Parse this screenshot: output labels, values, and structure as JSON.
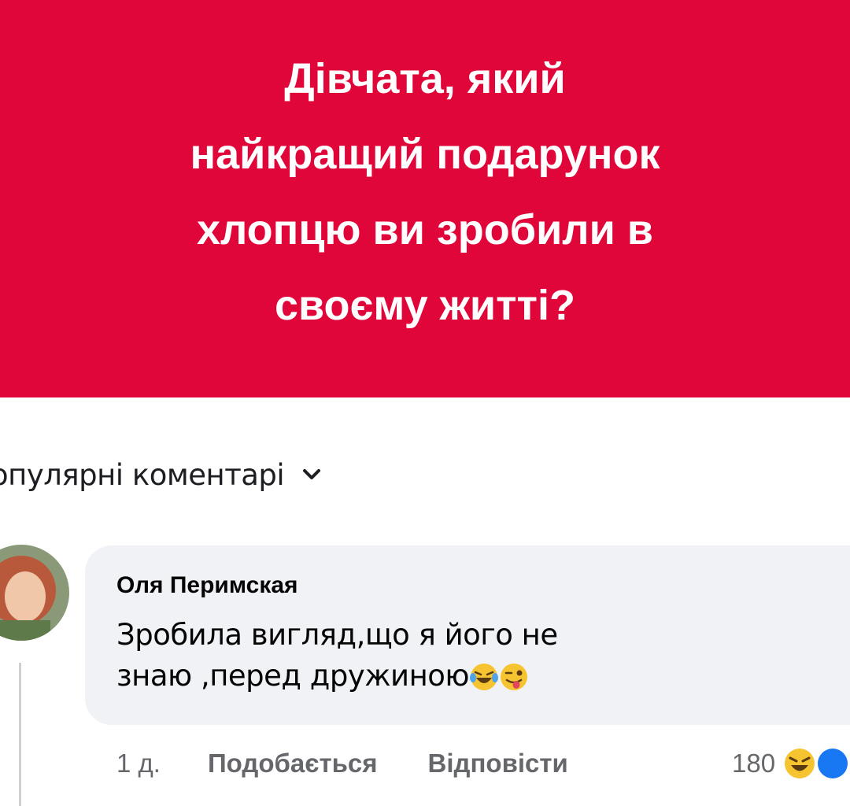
{
  "post": {
    "title": "Дівчата, який найкращий подарунок хлопцю ви зробили в своєму житті?",
    "title_lines": [
      "Дівчата, який",
      "найкращий подарунок",
      "хлопцю ви зробили в",
      "своєму житті?"
    ],
    "background_color": "#e0063a"
  },
  "comments_sort": {
    "label": "опулярні коментарі",
    "icon": "chevron-down-icon"
  },
  "comment": {
    "author": "Оля Перимская",
    "text_line1": "Зробила вигляд,що я його не",
    "text_line2": "знаю ,перед дружиною",
    "emojis": [
      "laughing-tears-emoji",
      "winking-tongue-emoji"
    ],
    "time": "1 д.",
    "like_label": "Подобається",
    "reply_label": "Відповісти",
    "reaction_count": "180",
    "reaction_icons": [
      "haha-reaction-icon",
      "like-reaction-icon"
    ]
  }
}
